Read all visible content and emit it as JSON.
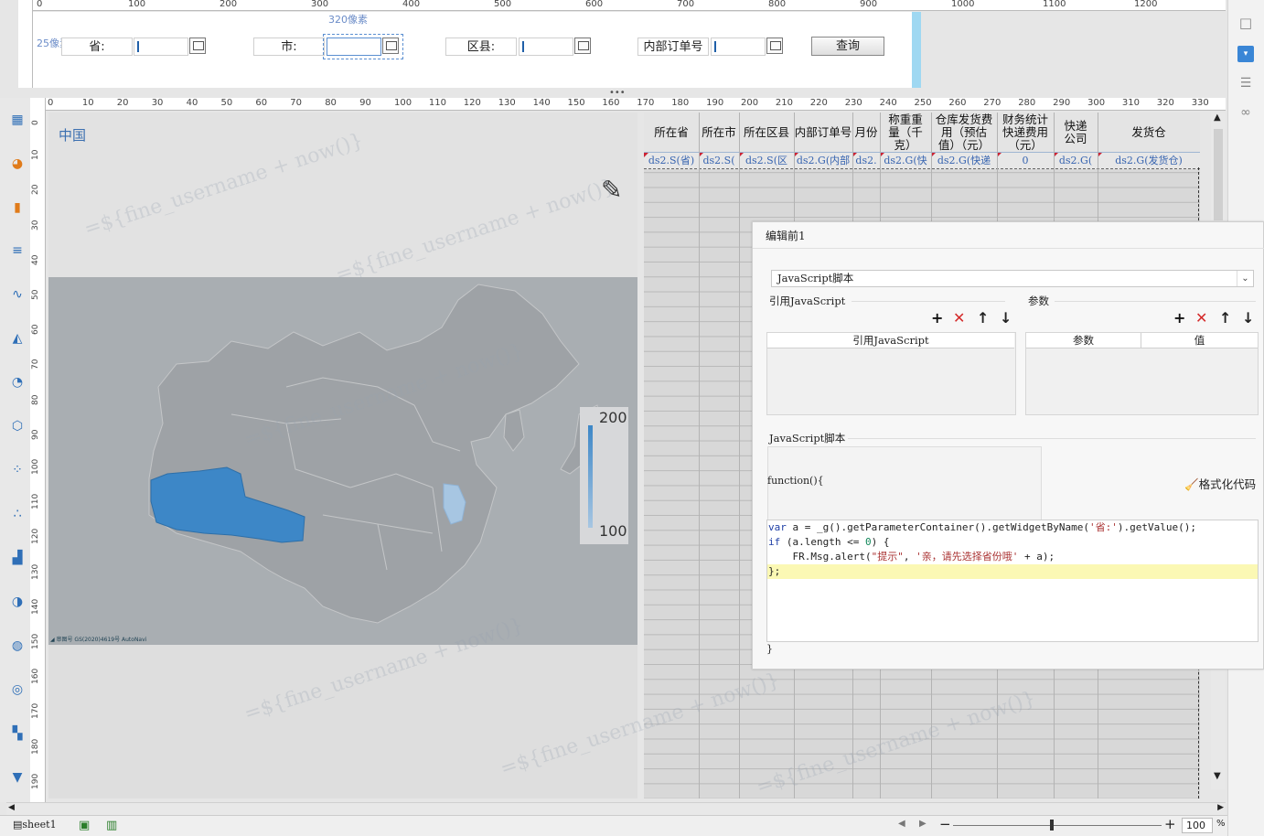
{
  "ruler_top": [
    "0",
    "100",
    "200",
    "300",
    "400",
    "500",
    "600",
    "700",
    "800",
    "900",
    "1000",
    "1100",
    "1200"
  ],
  "ruler_left_top": "0",
  "param_panel": {
    "px_label_1": "25像素",
    "px_label_2": "320像素",
    "labels": [
      "省:",
      "市:",
      "区县:",
      "内部订单号"
    ],
    "query_button": "查询"
  },
  "ruler_second": [
    "0",
    "10",
    "20",
    "30",
    "40",
    "50",
    "60",
    "70",
    "80",
    "90",
    "100",
    "110",
    "120",
    "130",
    "140",
    "150",
    "160",
    "170",
    "180",
    "190",
    "200",
    "210",
    "220",
    "230",
    "240",
    "250",
    "260",
    "270",
    "280",
    "290",
    "300",
    "310",
    "320",
    "330"
  ],
  "ruler_left": [
    "0",
    "10",
    "20",
    "30",
    "40",
    "50",
    "60",
    "70",
    "80",
    "90",
    "100",
    "110",
    "120",
    "130",
    "140",
    "150",
    "160",
    "170",
    "180",
    "190"
  ],
  "map": {
    "title": "中国",
    "legend_max": "200",
    "legend_min": "100",
    "attribution": "◢ 审图号 GS(2020)4619号 AutoNavi"
  },
  "sheet": {
    "headers": [
      "所在省",
      "所在市",
      "所在区县",
      "内部订单号",
      "月份",
      "称重重量（千克）",
      "仓库发货费用（预估值）（元）",
      "财务统计快递费用（元）",
      "快递公司",
      "发货仓"
    ],
    "cells": [
      "ds2.S(省)",
      "ds2.S(",
      "ds2.S(区",
      "ds2.G(内部",
      "ds2.",
      "ds2.G(快",
      "ds2.G(快递",
      "0",
      "ds2.G(",
      "ds2.G(发货仓)"
    ]
  },
  "dialog": {
    "title": "编辑前1",
    "type_select": "JavaScript脚本",
    "ref_js_label": "引用JavaScript",
    "params_label": "参数",
    "ref_js_col": "引用JavaScript",
    "param_col": "参数",
    "value_col": "值",
    "js_script_label": "JavaScript脚本",
    "function_header": "function(){",
    "format_button": "格式化代码",
    "code_lines": [
      "var a = _g().getParameterContainer().getWidgetByName('省:').getValue();",
      "if (a.length <= 0) {",
      "    FR.Msg.alert(\"提示\", '亲，请先选择省份哦' + a);",
      "};"
    ],
    "closing_brace": "}"
  },
  "bottom": {
    "sheet_tab": "sheet1",
    "zoom": "100",
    "zoom_unit": "%"
  },
  "watermark": "=${fine_username + now()}"
}
